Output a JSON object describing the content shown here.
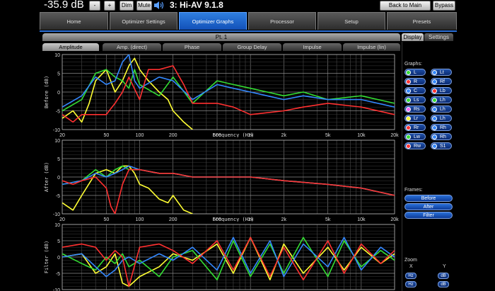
{
  "topbar": {
    "volume": "-35.9 dB",
    "minus_label": "-",
    "plus_label": "+",
    "dim_label": "Dim",
    "mute_label": "Mute",
    "preset_label": "3: Hi-AV 9.1.8",
    "back_label": "Back to Main Screen",
    "bypass_label": "Bypass"
  },
  "nav": {
    "tabs": [
      {
        "label": "Home"
      },
      {
        "label": "Optimizer Settings"
      },
      {
        "label": "Optimizer Graphs"
      },
      {
        "label": "Processor"
      },
      {
        "label": "Setup"
      },
      {
        "label": "Presets"
      }
    ]
  },
  "content": {
    "point_label": "Pt. 1",
    "subtabs": [
      {
        "label": "Amplitude"
      },
      {
        "label": "Amp. (direct)"
      },
      {
        "label": "Phase"
      },
      {
        "label": "Group Delay"
      },
      {
        "label": "Impulse"
      },
      {
        "label": "Impulse (lin)"
      }
    ]
  },
  "chart_data": [
    {
      "type": "line",
      "ylabel": "Before (dB)",
      "xlabel": "Frequency (Hz)",
      "xscale": "log",
      "xlim": [
        20,
        20000
      ],
      "ylim": [
        -10,
        10
      ],
      "x_ticks": [
        "20",
        "50",
        "100",
        "200",
        "500",
        "1k",
        "2k",
        "5k",
        "10k",
        "20k"
      ],
      "y_ticks": [
        "10",
        "5",
        "0",
        "-5",
        "-10"
      ],
      "grid": true,
      "series": [
        {
          "color": "#ffff33",
          "x": [
            20,
            25,
            30,
            35,
            40,
            50,
            60,
            70,
            80,
            90,
            100,
            120,
            150,
            180,
            200,
            250,
            300
          ],
          "y": [
            -7,
            -5,
            -8,
            -3,
            3,
            6,
            0,
            3,
            7,
            9,
            6,
            3,
            0,
            -2,
            -5,
            -8,
            -10
          ]
        },
        {
          "color": "#33dd33",
          "x": [
            20,
            30,
            40,
            50,
            60,
            70,
            80,
            90,
            100,
            150,
            200,
            300,
            500,
            700,
            1000,
            2000,
            3000,
            5000,
            10000,
            20000
          ],
          "y": [
            -5,
            -2,
            5,
            6,
            4,
            3,
            1,
            6,
            2,
            -1,
            4,
            -3,
            3,
            2,
            1,
            -1,
            0,
            -2,
            -1,
            -3
          ]
        },
        {
          "color": "#3388ff",
          "x": [
            20,
            30,
            40,
            50,
            60,
            70,
            80,
            90,
            100,
            150,
            200,
            300,
            500,
            700,
            1000,
            2000,
            3000,
            5000,
            10000,
            20000
          ],
          "y": [
            -4,
            -1,
            4,
            2,
            3,
            8,
            10,
            3,
            1,
            4,
            3,
            -2,
            2,
            1,
            0,
            -2,
            -1,
            -2,
            -2,
            -4
          ]
        },
        {
          "color": "#ff3030",
          "x": [
            20,
            25,
            30,
            40,
            50,
            60,
            70,
            80,
            100,
            120,
            150,
            200,
            250,
            300,
            500,
            700,
            1000,
            2000,
            3000,
            5000,
            10000,
            20000
          ],
          "y": [
            -6,
            -8,
            -6,
            -6,
            -6,
            -3,
            0,
            4,
            -2,
            6,
            6,
            7,
            2,
            -3,
            -3,
            -4,
            -6,
            -5,
            -4,
            -3,
            -4,
            -6
          ]
        }
      ]
    },
    {
      "type": "line",
      "ylabel": "After (dB)",
      "xlabel": "Frequency (Hz)",
      "xscale": "log",
      "xlim": [
        20,
        20000
      ],
      "ylim": [
        -10,
        10
      ],
      "x_ticks": [
        "20",
        "50",
        "100",
        "200",
        "500",
        "1k",
        "2k",
        "5k",
        "10k",
        "20k"
      ],
      "y_ticks": [
        "10",
        "5",
        "0",
        "-5",
        "-10"
      ],
      "grid": true,
      "series": [
        {
          "color": "#ffff33",
          "x": [
            20,
            25,
            30,
            40,
            50,
            60,
            70,
            80,
            90,
            100,
            120,
            150,
            180,
            200,
            250,
            300
          ],
          "y": [
            -7,
            -9,
            -5,
            1,
            2,
            1,
            3,
            3,
            1,
            -2,
            -3,
            -6,
            -7,
            -5,
            -9,
            -10
          ]
        },
        {
          "color": "#33dd33",
          "x": [
            20,
            30,
            40,
            50,
            60,
            70,
            80,
            100,
            150,
            200,
            300,
            500,
            1000,
            2000,
            5000,
            10000,
            20000
          ],
          "y": [
            -2,
            -1,
            2,
            0,
            2,
            3,
            2,
            2,
            1,
            1,
            0,
            0,
            0,
            -1,
            -2,
            -3,
            -5
          ]
        },
        {
          "color": "#3388ff",
          "x": [
            20,
            30,
            40,
            50,
            60,
            70,
            80,
            100,
            150,
            200,
            300,
            500,
            1000,
            2000,
            5000,
            10000,
            20000
          ],
          "y": [
            -2,
            -1,
            1,
            0,
            1,
            2,
            3,
            2,
            1,
            1,
            0,
            0,
            0,
            -1,
            -2,
            -3,
            -5
          ]
        },
        {
          "color": "#ff3030",
          "x": [
            20,
            25,
            30,
            40,
            50,
            55,
            60,
            70,
            80,
            100,
            150,
            200,
            300,
            500,
            1000,
            2000,
            5000,
            10000,
            20000
          ],
          "y": [
            -1,
            -2,
            -1,
            0,
            -3,
            -8,
            -10,
            -2,
            2,
            2,
            1,
            1,
            0,
            0,
            0,
            -1,
            -2,
            -3,
            -5
          ]
        }
      ]
    },
    {
      "type": "line",
      "ylabel": "Filter (dB)",
      "xscale": "log",
      "xlim": [
        20,
        20000
      ],
      "ylim": [
        -10,
        10
      ],
      "x_ticks": [],
      "y_ticks": [
        "10",
        "5",
        "0",
        "-5",
        "-10"
      ],
      "grid": true,
      "series": [
        {
          "color": "#ffff33",
          "x": [
            20,
            30,
            40,
            50,
            60,
            70,
            80,
            100,
            150,
            200,
            300,
            500,
            700,
            1000,
            1500,
            2000,
            3000,
            5000,
            7000,
            10000,
            15000,
            20000
          ],
          "y": [
            0,
            1,
            -5,
            -3,
            1,
            -8,
            -9,
            -6,
            -3,
            1,
            -1,
            4,
            -5,
            6,
            -7,
            4,
            -5,
            3,
            -4,
            3,
            -2,
            1
          ]
        },
        {
          "color": "#33dd33",
          "x": [
            20,
            30,
            40,
            50,
            60,
            70,
            80,
            100,
            150,
            200,
            300,
            500,
            700,
            1000,
            1500,
            2000,
            3000,
            5000,
            7000,
            10000,
            15000,
            20000
          ],
          "y": [
            1,
            -2,
            -4,
            0,
            -2,
            1,
            -3,
            -1,
            -6,
            0,
            2,
            -7,
            5,
            -6,
            4,
            -5,
            6,
            -6,
            5,
            -3,
            2,
            -1
          ]
        },
        {
          "color": "#3388ff",
          "x": [
            20,
            30,
            40,
            50,
            60,
            70,
            80,
            100,
            150,
            200,
            300,
            500,
            700,
            1000,
            1500,
            2000,
            3000,
            5000,
            7000,
            10000,
            15000,
            20000
          ],
          "y": [
            0,
            1,
            -3,
            -6,
            -4,
            -1,
            0,
            -2,
            1,
            -1,
            3,
            -4,
            6,
            -5,
            5,
            -6,
            4,
            -3,
            6,
            -4,
            3,
            0
          ]
        },
        {
          "color": "#ff3030",
          "x": [
            20,
            30,
            40,
            50,
            60,
            70,
            80,
            100,
            150,
            200,
            300,
            500,
            700,
            1000,
            1500,
            2000,
            3000,
            5000,
            7000,
            10000,
            15000,
            20000
          ],
          "y": [
            3,
            4,
            3,
            -1,
            2,
            0,
            -9,
            3,
            4,
            2,
            -2,
            5,
            -4,
            6,
            -6,
            3,
            -7,
            5,
            -5,
            4,
            -2,
            2
          ]
        }
      ]
    }
  ],
  "side": {
    "display_tab": "Display",
    "settings_tab": "Settings",
    "graphs_label": "Graphs:",
    "channels": [
      {
        "label": "L",
        "color": "#33dd33"
      },
      {
        "label": "Lt",
        "color": "#3388ff"
      },
      {
        "label": "R",
        "color": "#ff3030"
      },
      {
        "label": "Rf",
        "color": "#3388ff"
      },
      {
        "label": "C",
        "color": "#3388ff"
      },
      {
        "label": "Lb",
        "color": "#ff3030"
      },
      {
        "label": "Ls",
        "color": "#33dd33"
      },
      {
        "label": "Lh",
        "color": "#33dd33"
      },
      {
        "label": "Rs",
        "color": "#ff66ff"
      },
      {
        "label": "Lh",
        "color": "#3388ff"
      },
      {
        "label": "Lr",
        "color": "#ffff33"
      },
      {
        "label": "Lh",
        "color": "#3388ff"
      },
      {
        "label": "Rr",
        "color": "#ff3030"
      },
      {
        "label": "Rh",
        "color": "#3388ff"
      },
      {
        "label": "Lw",
        "color": "#33dd33"
      },
      {
        "label": "Rh",
        "color": "#3388ff"
      },
      {
        "label": "Rw",
        "color": "#ff3030"
      },
      {
        "label": "S1",
        "color": "#3388ff"
      }
    ],
    "frames_label": "Frames:",
    "frames": [
      {
        "label": "Before"
      },
      {
        "label": "After"
      },
      {
        "label": "Filter"
      }
    ],
    "zoom_label": "Zoom",
    "zoom_x": "X",
    "zoom_y": "Y",
    "zoom_hz": "Hz",
    "zoom_db": "dB"
  }
}
